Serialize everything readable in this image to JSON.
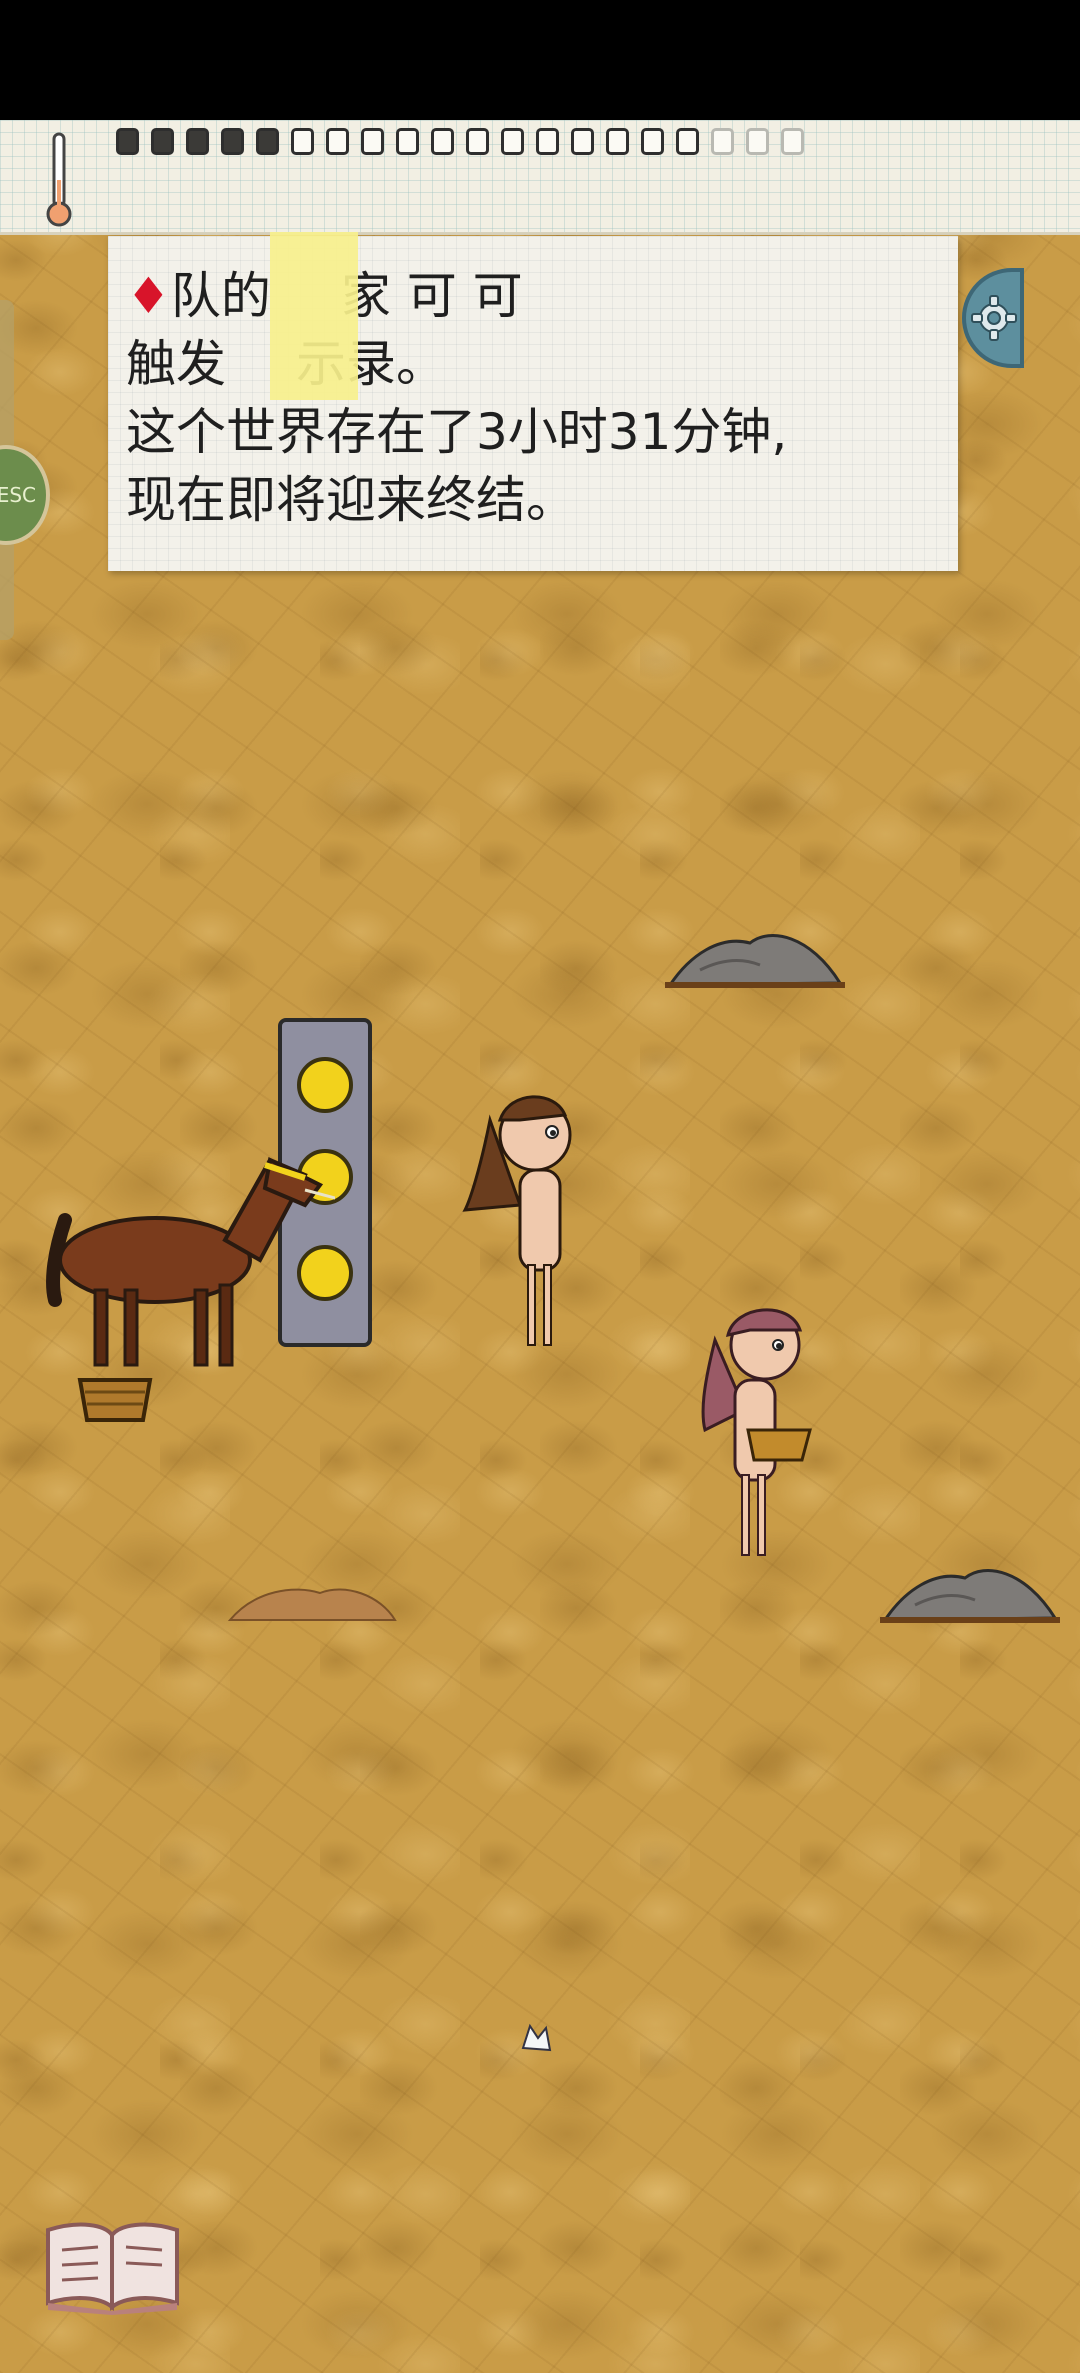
{
  "message": {
    "lines": [
      "队的",
      "家 可 可",
      "触发",
      "示录。",
      "这个世界存在了3小时31分钟,",
      "现在即将迎来终结。"
    ],
    "diamond": "♦"
  },
  "side_bubble_text": "ESC",
  "hud": {
    "food_pips_filled": 5,
    "food_pips_total": 20
  },
  "colors": {
    "ground": "#c99c47",
    "paper": "#f3f1ea",
    "tape": "#f7f08c",
    "diamond": "#d8142a",
    "settings": "#5d8f9e"
  },
  "icons": {
    "thermometer": "thermometer-icon",
    "settings": "gear-icon",
    "book": "book-icon"
  }
}
